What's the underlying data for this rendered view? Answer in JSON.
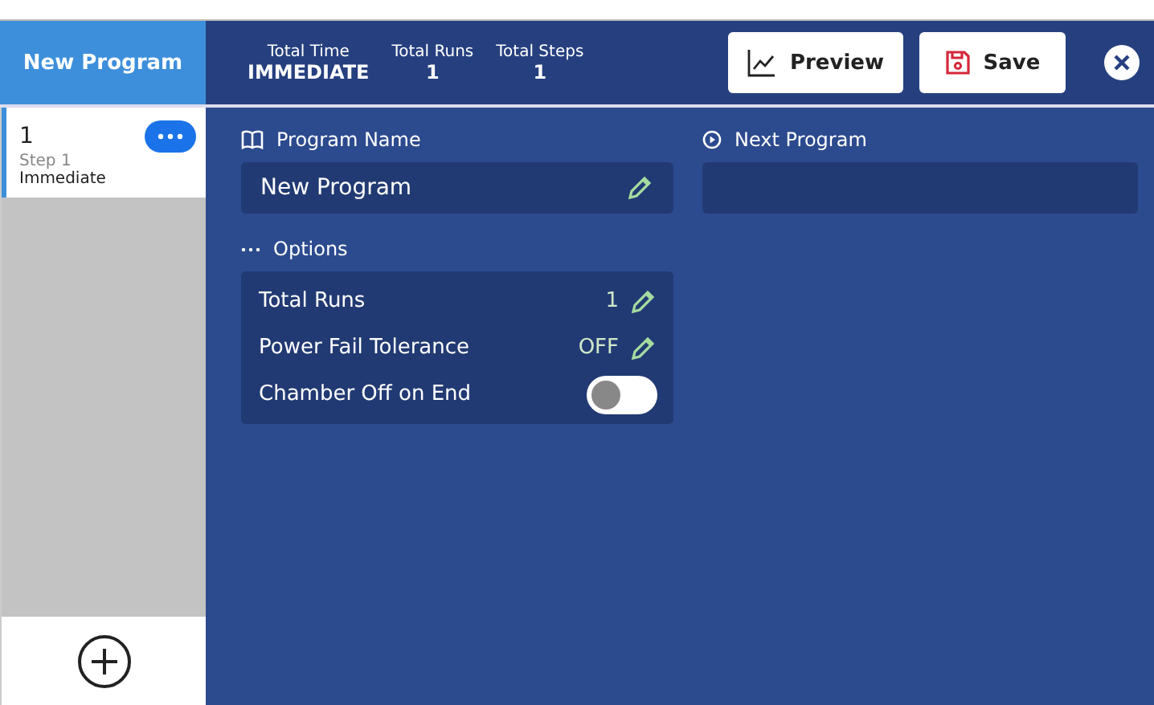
{
  "title": "New Program",
  "stats": [
    {
      "label": "Total Time",
      "value": "IMMEDIATE"
    },
    {
      "label": "Total Runs",
      "value": "1"
    },
    {
      "label": "Total Steps",
      "value": "1"
    }
  ],
  "buttons": [
    {
      "label": "Preview",
      "kind": "preview"
    },
    {
      "label": "Save",
      "kind": "save"
    }
  ],
  "steps": [
    {
      "number": "1",
      "name": "Step 1",
      "time": "Immediate",
      "selected": true
    }
  ],
  "program_name": {
    "label": "Program Name",
    "value": "New Program"
  },
  "next_program": {
    "label": "Next Program"
  },
  "options": {
    "label": "Options",
    "rows": [
      {
        "kind": "edit",
        "label": "Total Runs",
        "value": "1"
      },
      {
        "kind": "edit",
        "label": "Power Fail Tolerance",
        "value": "OFF"
      },
      {
        "kind": "toggle",
        "label": "Chamber Off on End",
        "on": false
      }
    ]
  }
}
